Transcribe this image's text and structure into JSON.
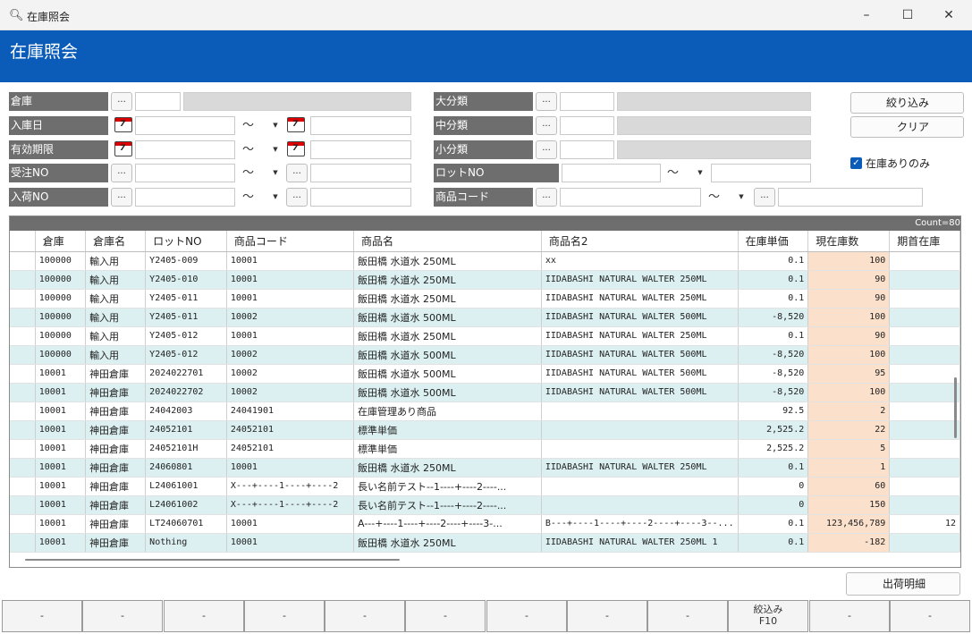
{
  "window": {
    "title": "在庫照会",
    "minimize": "–",
    "maximize": "☐",
    "close": "✕"
  },
  "banner": {
    "title": "在庫照会"
  },
  "filters": {
    "warehouse": {
      "label": "倉庫",
      "lookup": "...",
      "code": "",
      "name": ""
    },
    "receipt_date": {
      "label": "入庫日",
      "from": "",
      "sep": "～",
      "to": ""
    },
    "expiry": {
      "label": "有効期限",
      "from": "",
      "sep": "～",
      "to": ""
    },
    "order_no": {
      "label": "受注NO",
      "lookup": "...",
      "from": "",
      "sep": "～",
      "to": ""
    },
    "arrival_no": {
      "label": "入荷NO",
      "lookup": "...",
      "from": "",
      "sep": "～",
      "to": ""
    },
    "major_cat": {
      "label": "大分類",
      "lookup": "...",
      "code": "",
      "name": ""
    },
    "mid_cat": {
      "label": "中分類",
      "lookup": "...",
      "code": "",
      "name": ""
    },
    "minor_cat": {
      "label": "小分類",
      "lookup": "...",
      "code": "",
      "name": ""
    },
    "lot_no": {
      "label": "ロットNO",
      "from": "",
      "sep": "～",
      "to": ""
    },
    "product_code": {
      "label": "商品コード",
      "lookup": "...",
      "from": "",
      "sep": "～",
      "to": ""
    },
    "calendar_glyph": "7",
    "dropdown_glyph": "▼"
  },
  "actions": {
    "filter": "絞り込み",
    "clear": "クリア",
    "in_stock_only": "在庫ありのみ",
    "in_stock_checked": "✓",
    "shipment_details": "出荷明細"
  },
  "grid": {
    "count": "Count=80",
    "columns": [
      "倉庫",
      "倉庫名",
      "ロットNO",
      "商品コード",
      "商品名",
      "商品名2",
      "在庫単価",
      "現在庫数",
      "期首在庫"
    ],
    "rows": [
      [
        "100000",
        "輸入用",
        "Y2405-009",
        "10001",
        "飯田橋 水道水 250ML",
        "xx",
        "0.1",
        "100",
        ""
      ],
      [
        "100000",
        "輸入用",
        "Y2405-010",
        "10001",
        "飯田橋 水道水 250ML",
        "IIDABASHI NATURAL WALTER 250ML",
        "0.1",
        "90",
        ""
      ],
      [
        "100000",
        "輸入用",
        "Y2405-011",
        "10001",
        "飯田橋 水道水 250ML",
        "IIDABASHI NATURAL WALTER 250ML",
        "0.1",
        "90",
        ""
      ],
      [
        "100000",
        "輸入用",
        "Y2405-011",
        "10002",
        "飯田橋 水道水 500ML",
        "IIDABASHI NATURAL WALTER 500ML",
        "-8,520",
        "100",
        ""
      ],
      [
        "100000",
        "輸入用",
        "Y2405-012",
        "10001",
        "飯田橋 水道水 250ML",
        "IIDABASHI NATURAL WALTER 250ML",
        "0.1",
        "90",
        ""
      ],
      [
        "100000",
        "輸入用",
        "Y2405-012",
        "10002",
        "飯田橋 水道水 500ML",
        "IIDABASHI NATURAL WALTER 500ML",
        "-8,520",
        "100",
        ""
      ],
      [
        "10001",
        "神田倉庫",
        "2024022701",
        "10002",
        "飯田橋 水道水 500ML",
        "IIDABASHI NATURAL WALTER 500ML",
        "-8,520",
        "95",
        ""
      ],
      [
        "10001",
        "神田倉庫",
        "2024022702",
        "10002",
        "飯田橋 水道水 500ML",
        "IIDABASHI NATURAL WALTER 500ML",
        "-8,520",
        "100",
        ""
      ],
      [
        "10001",
        "神田倉庫",
        "24042003",
        "24041901",
        "在庫管理あり商品",
        "",
        "92.5",
        "2",
        ""
      ],
      [
        "10001",
        "神田倉庫",
        "24052101",
        "24052101",
        "標準単価",
        "",
        "2,525.2",
        "22",
        ""
      ],
      [
        "10001",
        "神田倉庫",
        "24052101H",
        "24052101",
        "標準単価",
        "",
        "2,525.2",
        "5",
        ""
      ],
      [
        "10001",
        "神田倉庫",
        "24060801",
        "10001",
        "飯田橋 水道水 250ML",
        "IIDABASHI NATURAL WALTER 250ML",
        "0.1",
        "1",
        ""
      ],
      [
        "10001",
        "神田倉庫",
        "L24061001",
        "X---+----1----+----2",
        "長い名前テスト--1----+----2----...",
        "",
        "0",
        "60",
        ""
      ],
      [
        "10001",
        "神田倉庫",
        "L24061002",
        "X---+----1----+----2",
        "長い名前テスト--1----+----2----...",
        "",
        "0",
        "150",
        ""
      ],
      [
        "10001",
        "神田倉庫",
        "LT24060701",
        "10001",
        "A---+----1----+----2----+----3-...",
        "B---+----1----+----2----+----3--...",
        "0.1",
        "123,456,789",
        "12"
      ],
      [
        "10001",
        "神田倉庫",
        "Nothing",
        "10001",
        "飯田橋 水道水 250ML",
        "IIDABASHI NATURAL WALTER 250ML 1",
        "0.1",
        "-182",
        ""
      ]
    ]
  },
  "fkeys": [
    {
      "l1": "-",
      "l2": ""
    },
    {
      "l1": "-",
      "l2": ""
    },
    {
      "l1": "-",
      "l2": ""
    },
    {
      "l1": "-",
      "l2": ""
    },
    {
      "l1": "-",
      "l2": ""
    },
    {
      "l1": "-",
      "l2": ""
    },
    {
      "l1": "-",
      "l2": ""
    },
    {
      "l1": "-",
      "l2": ""
    },
    {
      "l1": "-",
      "l2": ""
    },
    {
      "l1": "絞込み",
      "l2": "F10"
    },
    {
      "l1": "-",
      "l2": ""
    },
    {
      "l1": "-",
      "l2": ""
    }
  ]
}
